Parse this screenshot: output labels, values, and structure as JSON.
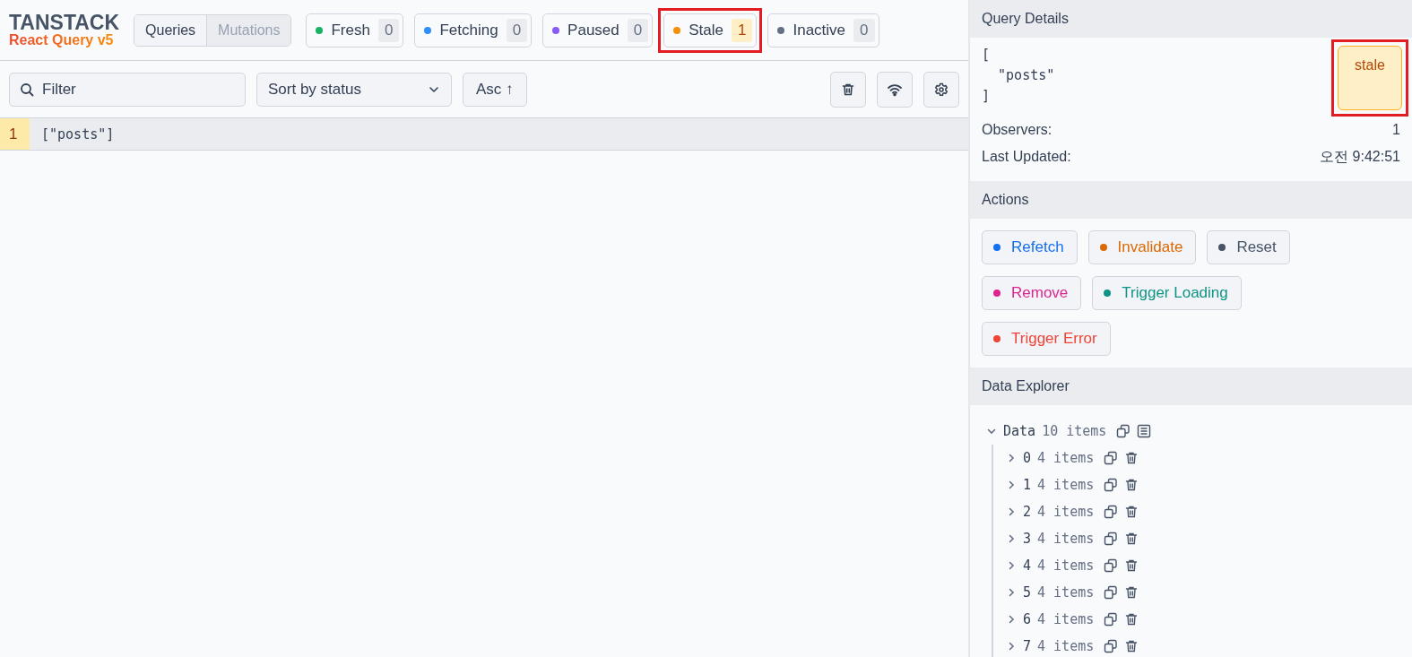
{
  "logo": {
    "title": "TANSTACK",
    "subtitle": "React Query v5"
  },
  "view_tabs": [
    {
      "label": "Queries",
      "selected": true
    },
    {
      "label": "Mutations",
      "selected": false
    }
  ],
  "statuses": [
    {
      "label": "Fresh",
      "count": "0",
      "color": "#16b364",
      "highlighted": false
    },
    {
      "label": "Fetching",
      "count": "0",
      "color": "#2e90fa",
      "highlighted": false
    },
    {
      "label": "Paused",
      "count": "0",
      "color": "#875bf7",
      "highlighted": false
    },
    {
      "label": "Stale",
      "count": "1",
      "color": "#f79009",
      "highlighted": true
    },
    {
      "label": "Inactive",
      "count": "0",
      "color": "#667085",
      "highlighted": false
    }
  ],
  "toolbar": {
    "filter_placeholder": "Filter",
    "sort": "Sort by status",
    "order": "Asc ↑"
  },
  "queries": [
    {
      "observers": "1",
      "key": "[\"posts\"]",
      "color": "#fde9a8",
      "selected": true
    }
  ],
  "details": {
    "title": "Query Details",
    "key_lines": [
      "[",
      "  \"posts\"",
      "]"
    ],
    "status": "stale",
    "status_highlighted": true,
    "rows": [
      {
        "label": "Observers:",
        "value": "1"
      },
      {
        "label": "Last Updated:",
        "value": "오전 9:42:51"
      }
    ]
  },
  "actions": {
    "title": "Actions",
    "buttons": [
      {
        "label": "Refetch",
        "color": "#1570ef"
      },
      {
        "label": "Invalidate",
        "color": "#dc6803"
      },
      {
        "label": "Reset",
        "color": "#475467"
      },
      {
        "label": "Remove",
        "color": "#dd2590"
      },
      {
        "label": "Trigger Loading",
        "color": "#0e9384"
      },
      {
        "label": "Trigger Error",
        "color": "#f04438"
      }
    ]
  },
  "explorer": {
    "title": "Data Explorer",
    "root": {
      "label": "Data",
      "summary": "10 items",
      "expanded": true,
      "children": [
        {
          "label": "0",
          "summary": "4 items",
          "expanded": false
        },
        {
          "label": "1",
          "summary": "4 items",
          "expanded": false
        },
        {
          "label": "2",
          "summary": "4 items",
          "expanded": false
        },
        {
          "label": "3",
          "summary": "4 items",
          "expanded": false
        },
        {
          "label": "4",
          "summary": "4 items",
          "expanded": false
        },
        {
          "label": "5",
          "summary": "4 items",
          "expanded": false
        },
        {
          "label": "6",
          "summary": "4 items",
          "expanded": false
        },
        {
          "label": "7",
          "summary": "4 items",
          "expanded": false
        }
      ]
    }
  }
}
